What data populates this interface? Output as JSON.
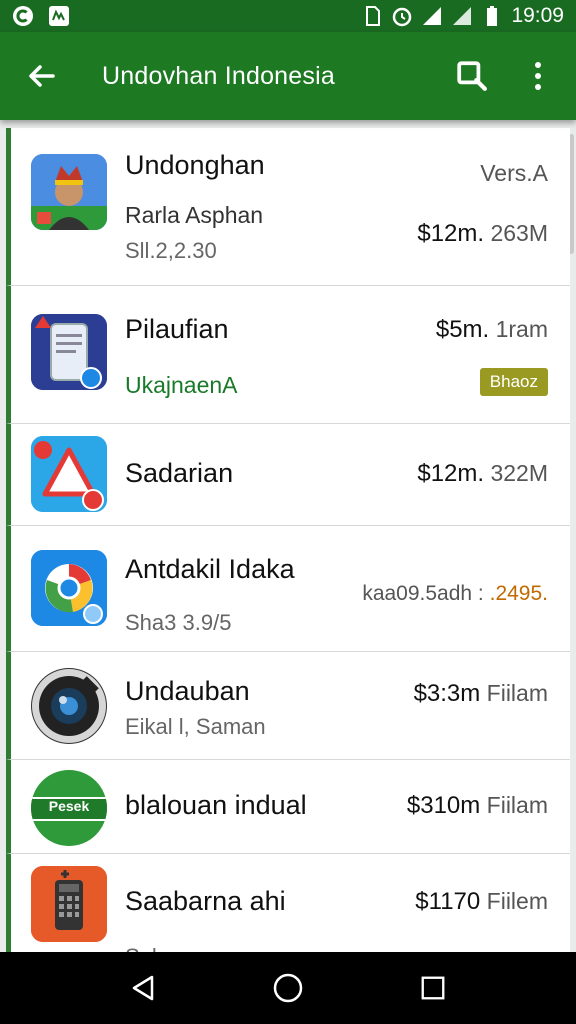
{
  "status_bar": {
    "time": "19:09",
    "left_icons": [
      "notification-c-icon",
      "notification-app-icon"
    ],
    "right_icons": [
      "sim-icon",
      "alarm-icon",
      "signal-icon",
      "signal-icon",
      "battery-icon"
    ]
  },
  "app_bar": {
    "title": "Undovhan Indonesia",
    "back_icon": "back-arrow-icon",
    "search_icon": "search-icon",
    "menu_icon": "overflow-menu-icon"
  },
  "colors": {
    "primary": "#1d7a23",
    "status": "#1a6b22",
    "accent_green": "#1b7a2a",
    "badge": "#9a9a22"
  },
  "list": [
    {
      "name": "Undonghan",
      "sub": "Rarla Asphan",
      "sub2": "Sll.2,2.30",
      "right_top": "Vers.A",
      "right_mid": "$12m.",
      "right_mid2": "263M",
      "icon": "portrait-icon"
    },
    {
      "name": "Pilaufian",
      "sub": "UkajnaenA",
      "right_top": "$5m.",
      "right_top2": "1ram",
      "badge": "Bhaoz",
      "icon": "phone-document-icon"
    },
    {
      "name": "Sadarian",
      "right_top": "$12m.",
      "right_top2": "322M",
      "icon": "warning-triangle-icon"
    },
    {
      "name": "Antdakil Idaka",
      "sub2": "Sha3 3.9/5",
      "right_top": "kaa09.5adh :",
      "right_top2": ".2495.",
      "icon": "browser-globe-icon"
    },
    {
      "name": "Undauban",
      "sub2": "Eikal l, Saman",
      "right_top": "$3:3m",
      "right_top2": "Fiilam",
      "icon": "camera-lens-icon"
    },
    {
      "name": "blalouan indual",
      "right_top": "$310m",
      "right_top2": "Fiilam",
      "icon": "green-badge-icon",
      "icon_text": "Pesek"
    },
    {
      "name": "Saabarna ahi",
      "sub2": "Sal...",
      "right_top": "$1170",
      "right_top2": "Fiilem",
      "icon": "calculator-icon"
    }
  ],
  "nav_bar": {
    "back": "nav-back-icon",
    "home": "nav-home-icon",
    "recents": "nav-recents-icon"
  }
}
